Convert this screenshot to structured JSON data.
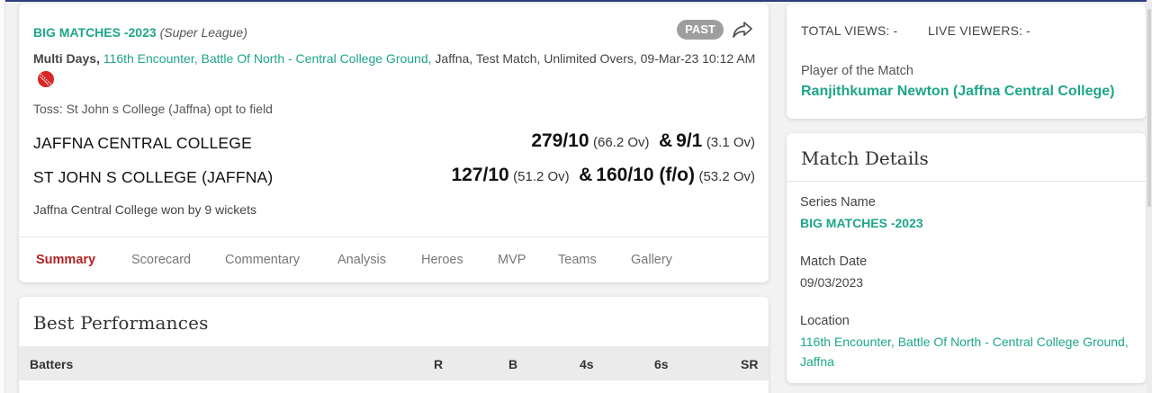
{
  "match": {
    "series_name": "BIG MATCHES -2023",
    "league": "(Super League)",
    "badge": "PAST",
    "format": "Multi Days,",
    "venue": "116th Encounter, Battle Of North - Central College Ground,",
    "details_rest": "Jaffna, Test Match, Unlimited Overs, 09-Mar-23 10:12 AM",
    "toss": "Toss: St John s College (Jaffna) opt to field",
    "teams": [
      {
        "name": "JAFFNA CENTRAL COLLEGE",
        "inn1_score": "279/10",
        "inn1_overs": "(66.2 Ov)",
        "amp": "&",
        "inn2_score": "9/1",
        "inn2_overs": "(3.1 Ov)"
      },
      {
        "name": "ST JOHN S COLLEGE (JAFFNA)",
        "inn1_score": "127/10",
        "inn1_overs": "(51.2 Ov)",
        "amp": "&",
        "inn2_score": "160/10 (f/o)",
        "inn2_overs": "(53.2 Ov)"
      }
    ],
    "result": "Jaffna Central College won by 9 wickets",
    "tabs": [
      "Summary",
      "Scorecard",
      "Commentary",
      "Analysis",
      "Heroes",
      "MVP",
      "Teams",
      "Gallery"
    ],
    "active_tab": "Summary"
  },
  "best_performances": {
    "title": "Best Performances",
    "columns": [
      "Batters",
      "R",
      "B",
      "4s",
      "6s",
      "SR"
    ]
  },
  "views": {
    "total_label": "TOTAL VIEWS:",
    "total_value": "-",
    "live_label": "LIVE VIEWERS:",
    "live_value": "-",
    "pom_label": "Player of the Match",
    "pom_name": "Ranjithkumar Newton (Jaffna Central College)"
  },
  "details": {
    "title": "Match Details",
    "series_label": "Series Name",
    "series_value": "BIG MATCHES -2023",
    "date_label": "Match Date",
    "date_value": "09/03/2023",
    "location_label": "Location",
    "location_value": "116th Encounter, Battle Of North - Central College Ground, Jaffna"
  },
  "colors": {
    "accent_green": "#1da68a",
    "active_tab": "#b22222",
    "badge_grey": "#9e9e9e",
    "ball_red": "#d62828"
  },
  "icons": {
    "share": "share-arrow-icon",
    "ball": "cricket-ball-icon"
  }
}
